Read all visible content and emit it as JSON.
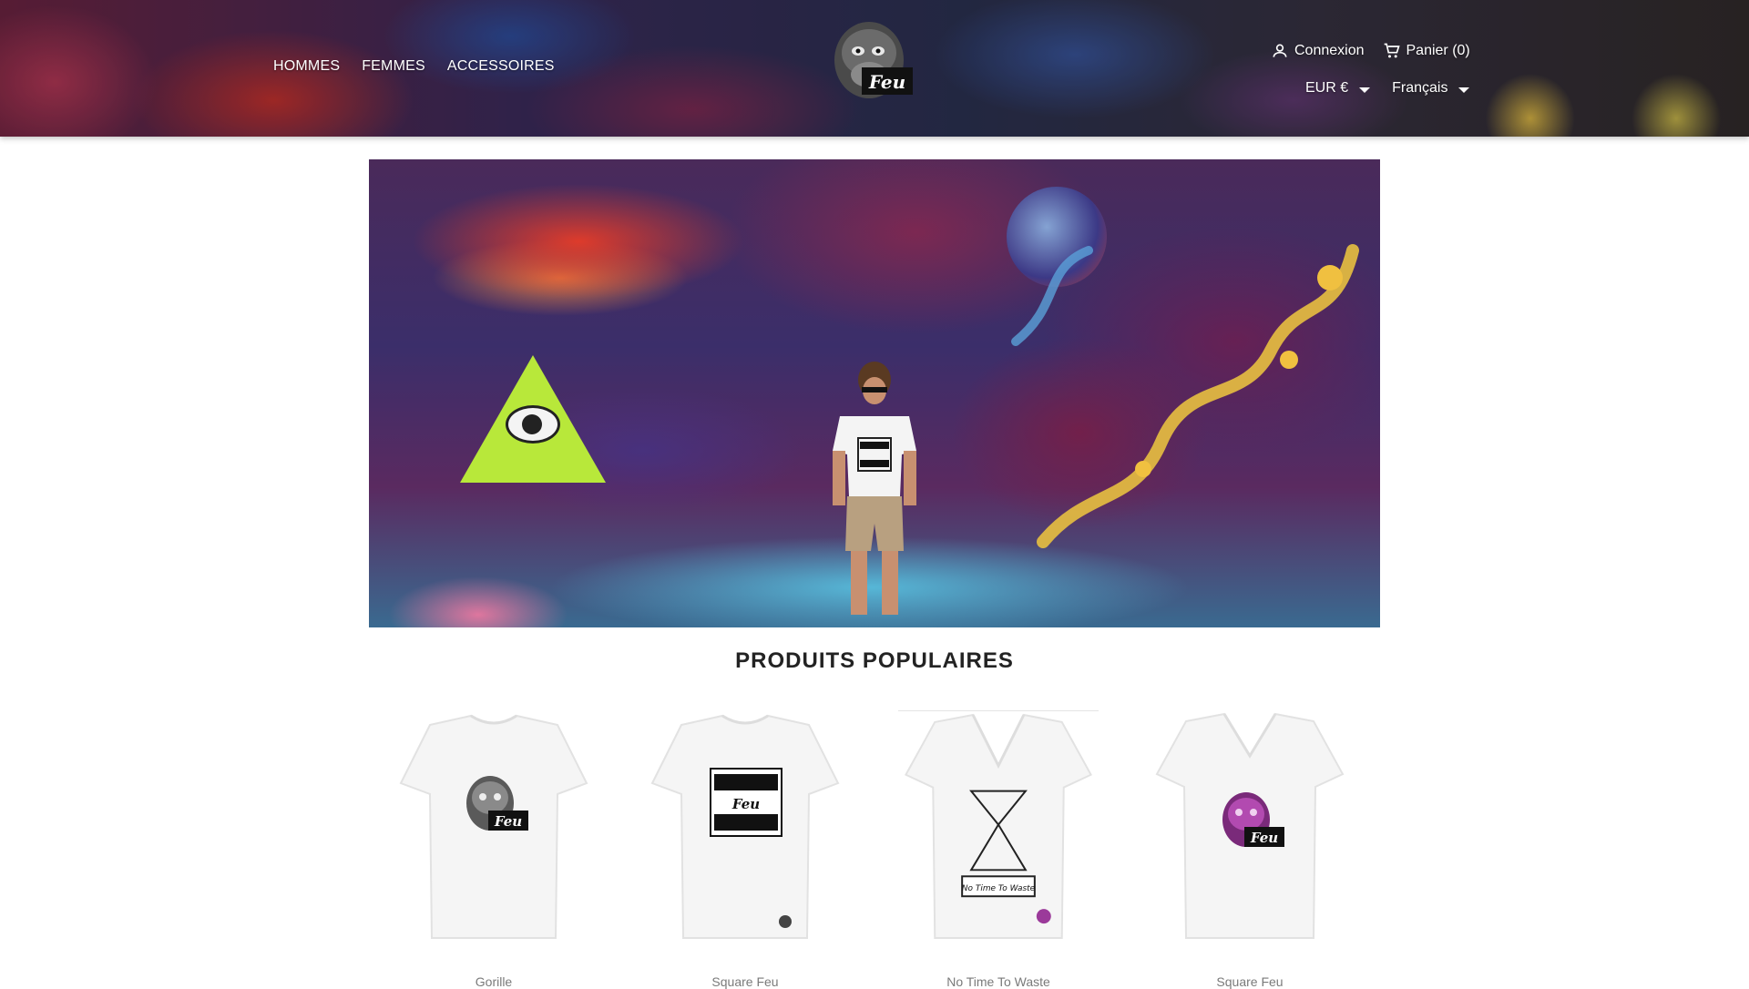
{
  "header": {
    "nav": [
      "HOMMES",
      "FEMMES",
      "ACCESSOIRES"
    ],
    "logo_text": "Feu",
    "connexion_label": "Connexion",
    "cart_label": "Panier (0)",
    "currency": "EUR €",
    "language": "Français",
    "icons": {
      "user": "user-icon",
      "cart": "cart-icon"
    }
  },
  "hero": {
    "alt": "graffiti-wall-banner"
  },
  "section": {
    "title": "PRODUITS POPULAIRES"
  },
  "products": [
    {
      "name": "Gorille"
    },
    {
      "name": "Square Feu"
    },
    {
      "name": "No Time To Waste"
    },
    {
      "name": "Square Feu"
    }
  ],
  "colors": {
    "text_dark": "#232323",
    "text_muted": "#7a7a7a",
    "gorilla_purple": "#9b3a9a"
  }
}
